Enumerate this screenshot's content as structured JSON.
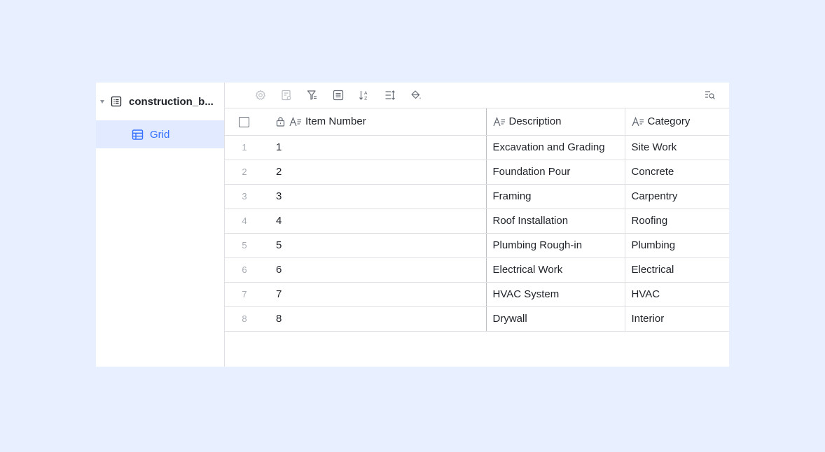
{
  "sidebar": {
    "table_name": "construction_b...",
    "view_name": "Grid"
  },
  "toolbar": {
    "icons": [
      "settings-icon",
      "form-icon",
      "filter-icon",
      "group-icon",
      "sort-icon",
      "row-height-icon",
      "fill-color-icon",
      "search-icon"
    ]
  },
  "table": {
    "columns": {
      "item_number": "Item Number",
      "description": "Description",
      "category": "Category"
    },
    "rows": [
      {
        "index": "1",
        "item_number": "1",
        "description": "Excavation and Grading",
        "category": "Site Work"
      },
      {
        "index": "2",
        "item_number": "2",
        "description": "Foundation Pour",
        "category": "Concrete"
      },
      {
        "index": "3",
        "item_number": "3",
        "description": "Framing",
        "category": "Carpentry"
      },
      {
        "index": "4",
        "item_number": "4",
        "description": "Roof Installation",
        "category": "Roofing"
      },
      {
        "index": "5",
        "item_number": "5",
        "description": "Plumbing Rough-in",
        "category": "Plumbing"
      },
      {
        "index": "6",
        "item_number": "6",
        "description": "Electrical Work",
        "category": "Electrical"
      },
      {
        "index": "7",
        "item_number": "7",
        "description": "HVAC System",
        "category": "HVAC"
      },
      {
        "index": "8",
        "item_number": "8",
        "description": "Drywall",
        "category": "Interior"
      }
    ]
  },
  "colors": {
    "accent": "#3370ff",
    "selected_bg": "#e1eaff",
    "page_bg": "#e8effe"
  }
}
